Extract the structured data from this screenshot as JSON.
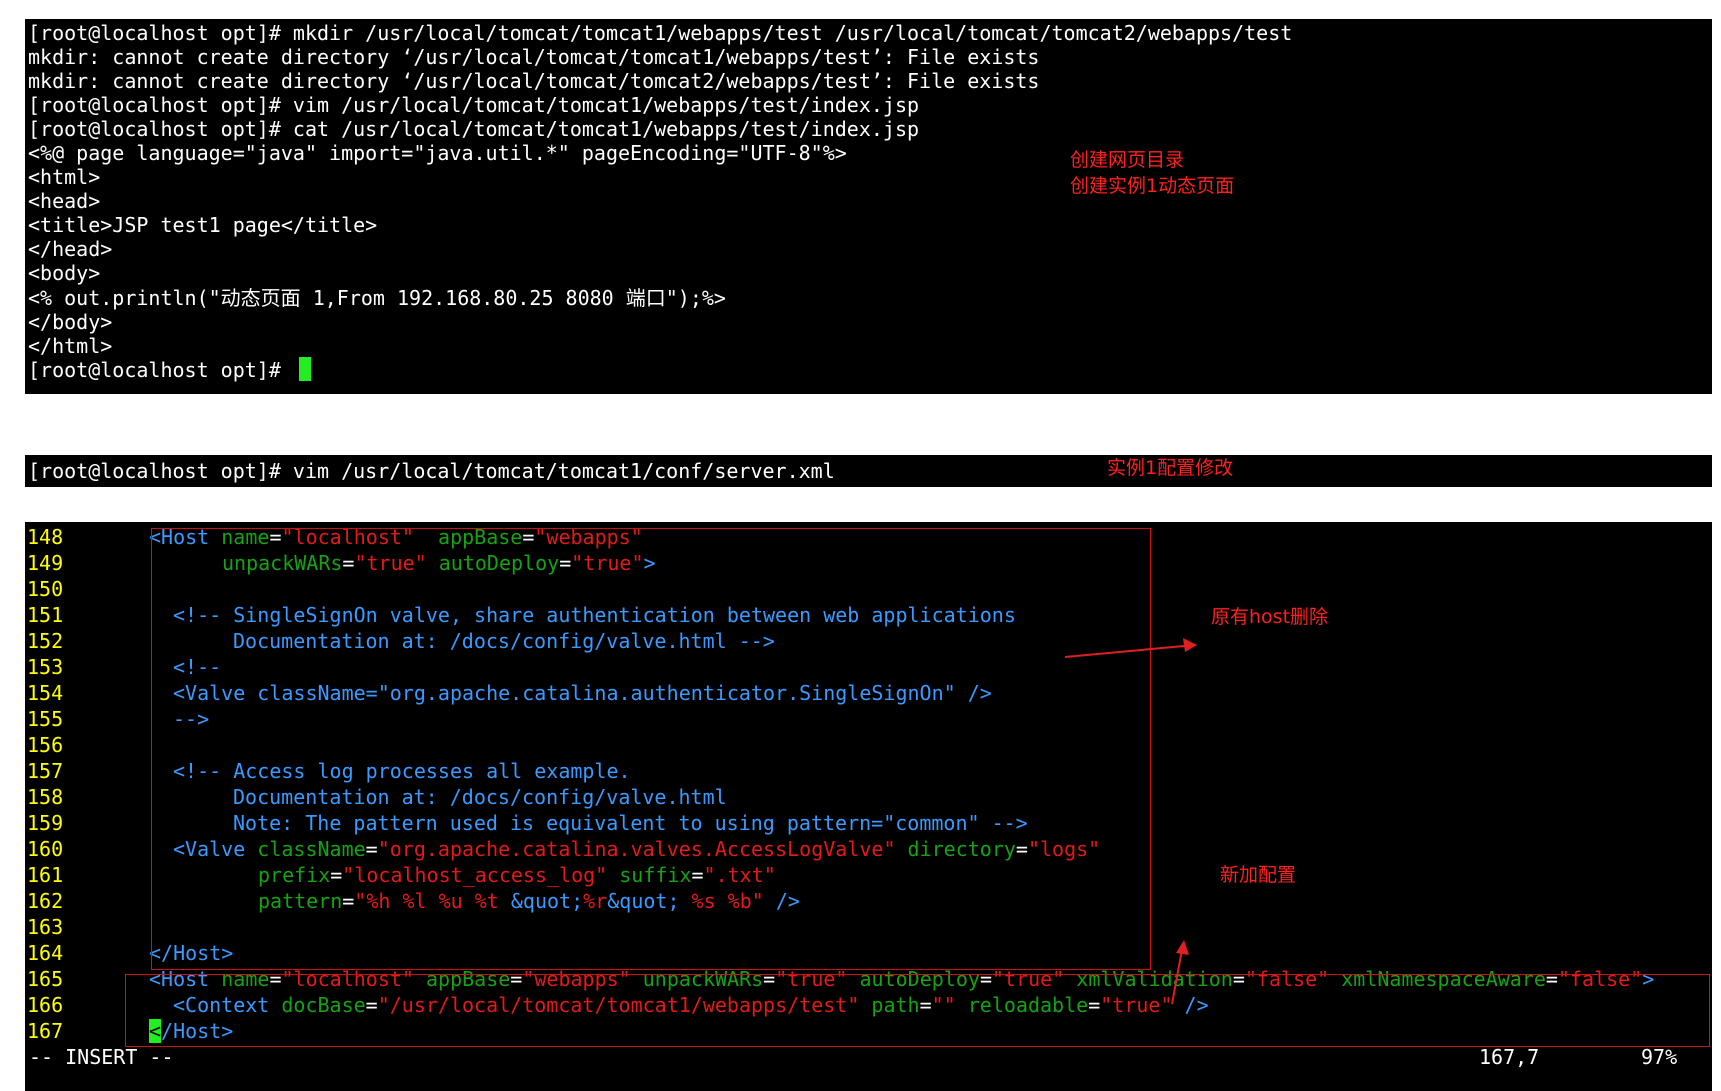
{
  "terminal1": {
    "lines": [
      "[root@localhost opt]# mkdir /usr/local/tomcat/tomcat1/webapps/test /usr/local/tomcat/tomcat2/webapps/test",
      "mkdir: cannot create directory ‘/usr/local/tomcat/tomcat1/webapps/test’: File exists",
      "mkdir: cannot create directory ‘/usr/local/tomcat/tomcat2/webapps/test’: File exists",
      "[root@localhost opt]# vim /usr/local/tomcat/tomcat1/webapps/test/index.jsp",
      "[root@localhost opt]# cat /usr/local/tomcat/tomcat1/webapps/test/index.jsp",
      "<%@ page language=\"java\" import=\"java.util.*\" pageEncoding=\"UTF-8\"%>",
      "<html>",
      "<head>",
      "<title>JSP test1 page</title>",
      "</head>",
      "<body>",
      "<% out.println(\"动态页面 1,From 192.168.80.25 8080 端口\");%>",
      "</body>",
      "</html>",
      "[root@localhost opt]# "
    ],
    "annotation_line1": "创建网页目录",
    "annotation_line2": "创建实例1动态页面"
  },
  "terminal2": {
    "command": "[root@localhost opt]# vim /usr/local/tomcat/tomcat1/conf/server.xml",
    "annotation": "实例1配置修改"
  },
  "editor": {
    "line_numbers": [
      "148",
      "149",
      "150",
      "151",
      "152",
      "153",
      "154",
      "155",
      "156",
      "157",
      "158",
      "159",
      "160",
      "161",
      "162",
      "163",
      "164",
      "165",
      "166",
      "167"
    ],
    "code": {
      "l148_host": "<Host",
      "l148_name_attr": "name",
      "l148_name_val": "\"localhost\"",
      "l148_appbase_attr": "appBase",
      "l148_appbase_val": "\"webapps\"",
      "l149_unpack_attr": "unpackWARs",
      "l149_unpack_val": "\"true\"",
      "l149_autodeploy_attr": "autoDeploy",
      "l149_autodeploy_val": "\"true\"",
      "l149_close": ">",
      "l151": "<!-- SingleSignOn valve, share authentication between web applications",
      "l152": "Documentation at: /docs/config/valve.html -->",
      "l153": "<!--",
      "l154": "<Valve className=\"org.apache.catalina.authenticator.SingleSignOn\" />",
      "l155": "-->",
      "l157": "<!-- Access log processes all example.",
      "l158": "Documentation at: /docs/config/valve.html",
      "l159": "Note: The pattern used is equivalent to using pattern=\"common\" -->",
      "l160_valve": "<Valve",
      "l160_class_attr": "className",
      "l160_class_val": "\"org.apache.catalina.valves.AccessLogValve\"",
      "l160_dir_attr": "directory",
      "l160_dir_val": "\"logs\"",
      "l161_prefix_attr": "prefix",
      "l161_prefix_val": "\"localhost_access_log\"",
      "l161_suffix_attr": "suffix",
      "l161_suffix_val": "\".txt\"",
      "l162_pattern_attr": "pattern",
      "l162_p1": "\"%h %l %u %t ",
      "l162_quot1": "&quot;",
      "l162_p2": "%r",
      "l162_quot2": "&quot;",
      "l162_p3": " %s %b\"",
      "l162_close": " />",
      "l164": "</Host>",
      "l165_host": "<Host",
      "l165_name_attr": "name",
      "l165_name_val": "\"localhost\"",
      "l165_appbase_attr": "appBase",
      "l165_appbase_val": "\"webapps\"",
      "l165_unpack_attr": "unpackWARs",
      "l165_unpack_val": "\"true\"",
      "l165_autodeploy_attr": "autoDeploy",
      "l165_autodeploy_val": "\"true\"",
      "l165_xmlval_attr": "xmlValidation",
      "l165_xmlval_val": "\"false\"",
      "l165_xmlns_attr": "xmlNamespaceAware",
      "l165_xmlns_val": "\"false\"",
      "l165_close": ">",
      "l166_context": "<Context",
      "l166_docbase_attr": "docBase",
      "l166_docbase_val": "\"/usr/local/tomcat/tomcat1/webapps/test\"",
      "l166_path_attr": "path",
      "l166_path_val": "\"\"",
      "l166_reload_attr": "reloadable",
      "l166_reload_val": "\"true\"",
      "l166_close": " />",
      "l167_cursor_char": "<",
      "l167_rest": "/Host>"
    },
    "annotation_delete": "原有host删除",
    "annotation_new": "新加配置",
    "status_mode": "-- INSERT --",
    "status_position": "167,7",
    "status_percent": "97%"
  },
  "colors": {
    "line_number": "#ffff00",
    "tag": "#3a9aff",
    "attribute": "#13a313",
    "string": "#e21a1a",
    "cursor": "#22ee22",
    "annotation": "#ff2020"
  }
}
